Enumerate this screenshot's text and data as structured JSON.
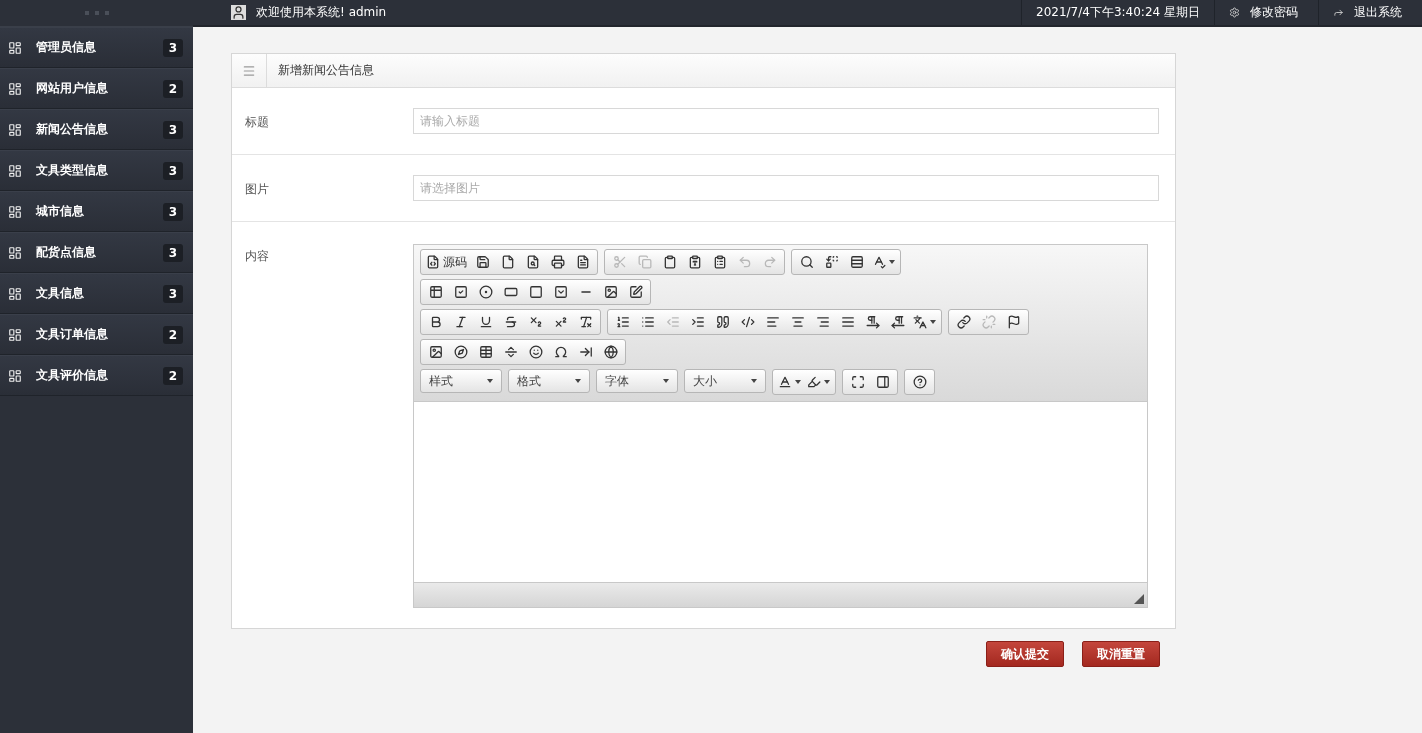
{
  "topbar": {
    "welcome": "欢迎使用本系统! admin",
    "datetime": "2021/7/4下午3:40:24 星期日",
    "actions": [
      {
        "label": "修改密码",
        "kind": "settings"
      },
      {
        "label": "退出系统",
        "kind": "logout"
      }
    ]
  },
  "sidebar": {
    "items": [
      {
        "label": "管理员信息",
        "count": "3"
      },
      {
        "label": "网站用户信息",
        "count": "2"
      },
      {
        "label": "新闻公告信息",
        "count": "3"
      },
      {
        "label": "文具类型信息",
        "count": "3"
      },
      {
        "label": "城市信息",
        "count": "3"
      },
      {
        "label": "配货点信息",
        "count": "3"
      },
      {
        "label": "文具信息",
        "count": "3"
      },
      {
        "label": "文具订单信息",
        "count": "2"
      },
      {
        "label": "文具评价信息",
        "count": "2"
      }
    ]
  },
  "form": {
    "title": "新增新闻公告信息",
    "fields": [
      {
        "label": "标题",
        "kind": "text",
        "placeholder": "请输入标题"
      },
      {
        "label": "图片",
        "kind": "text",
        "placeholder": "请选择图片"
      },
      {
        "label": "内容",
        "kind": "editor"
      }
    ],
    "editor": {
      "rows": [
        [
          {
            "buttons": [
              {
                "kind": "icon-label",
                "label": "源码",
                "disabled": false
              },
              {
                "kind": "icon",
                "disabled": false
              },
              {
                "kind": "icon",
                "disabled": false
              },
              {
                "kind": "icon",
                "disabled": false
              },
              {
                "kind": "icon",
                "disabled": false
              },
              {
                "kind": "icon",
                "disabled": false
              }
            ]
          },
          {
            "buttons": [
              {
                "kind": "icon",
                "disabled": true
              },
              {
                "kind": "icon",
                "disabled": true
              },
              {
                "kind": "icon",
                "disabled": false
              },
              {
                "kind": "icon",
                "disabled": false
              },
              {
                "kind": "icon",
                "disabled": false
              },
              {
                "kind": "icon",
                "disabled": true
              },
              {
                "kind": "icon",
                "disabled": true
              }
            ]
          },
          {
            "buttons": [
              {
                "kind": "icon",
                "disabled": false
              },
              {
                "kind": "icon",
                "disabled": false
              },
              {
                "kind": "icon",
                "disabled": false
              },
              {
                "kind": "menu",
                "disabled": false
              }
            ]
          }
        ],
        [
          {
            "buttons": [
              {
                "kind": "icon",
                "disabled": false
              },
              {
                "kind": "icon",
                "disabled": false
              },
              {
                "kind": "icon",
                "disabled": false
              },
              {
                "kind": "icon",
                "disabled": false
              },
              {
                "kind": "icon",
                "disabled": false
              },
              {
                "kind": "icon",
                "disabled": false
              },
              {
                "kind": "icon",
                "disabled": false
              },
              {
                "kind": "icon",
                "disabled": false
              },
              {
                "kind": "icon",
                "disabled": false
              }
            ]
          }
        ],
        [
          {
            "buttons": [
              {
                "kind": "icon",
                "disabled": false
              },
              {
                "kind": "icon",
                "disabled": false
              },
              {
                "kind": "icon",
                "disabled": false
              },
              {
                "kind": "icon",
                "disabled": false
              },
              {
                "kind": "icon",
                "disabled": false
              },
              {
                "kind": "icon",
                "disabled": false
              },
              {
                "kind": "icon",
                "disabled": false
              }
            ]
          },
          {
            "buttons": [
              {
                "kind": "icon",
                "disabled": false
              },
              {
                "kind": "icon",
                "disabled": false
              },
              {
                "kind": "icon",
                "disabled": true
              },
              {
                "kind": "icon",
                "disabled": false
              },
              {
                "kind": "icon",
                "disabled": false
              },
              {
                "kind": "icon",
                "disabled": false
              },
              {
                "kind": "icon",
                "disabled": false
              },
              {
                "kind": "icon",
                "disabled": false
              },
              {
                "kind": "icon",
                "disabled": false
              },
              {
                "kind": "icon",
                "disabled": false
              },
              {
                "kind": "icon",
                "disabled": false
              },
              {
                "kind": "icon",
                "disabled": false
              },
              {
                "kind": "menu",
                "disabled": false
              }
            ]
          },
          {
            "buttons": [
              {
                "kind": "icon",
                "disabled": false
              },
              {
                "kind": "icon",
                "disabled": true
              },
              {
                "kind": "icon",
                "disabled": false
              }
            ]
          }
        ],
        [
          {
            "buttons": [
              {
                "kind": "icon",
                "disabled": false
              },
              {
                "kind": "icon",
                "disabled": false
              },
              {
                "kind": "icon",
                "disabled": false
              },
              {
                "kind": "icon",
                "disabled": false
              },
              {
                "kind": "icon",
                "disabled": false
              },
              {
                "kind": "icon",
                "disabled": false
              },
              {
                "kind": "icon",
                "disabled": false
              },
              {
                "kind": "icon",
                "disabled": false
              }
            ]
          }
        ],
        [
          {
            "kind": "combo",
            "label": "样式"
          },
          {
            "kind": "combo",
            "label": "格式"
          },
          {
            "kind": "combo",
            "label": "字体"
          },
          {
            "kind": "combo",
            "label": "大小"
          },
          {
            "buttons": [
              {
                "kind": "menu",
                "disabled": false
              },
              {
                "kind": "menu",
                "disabled": false
              }
            ]
          },
          {
            "buttons": [
              {
                "kind": "icon",
                "disabled": false
              },
              {
                "kind": "icon",
                "disabled": false
              }
            ]
          },
          {
            "buttons": [
              {
                "kind": "icon",
                "disabled": false
              }
            ]
          }
        ]
      ]
    }
  },
  "buttons": [
    {
      "label": "确认提交"
    },
    {
      "label": "取消重置"
    }
  ]
}
